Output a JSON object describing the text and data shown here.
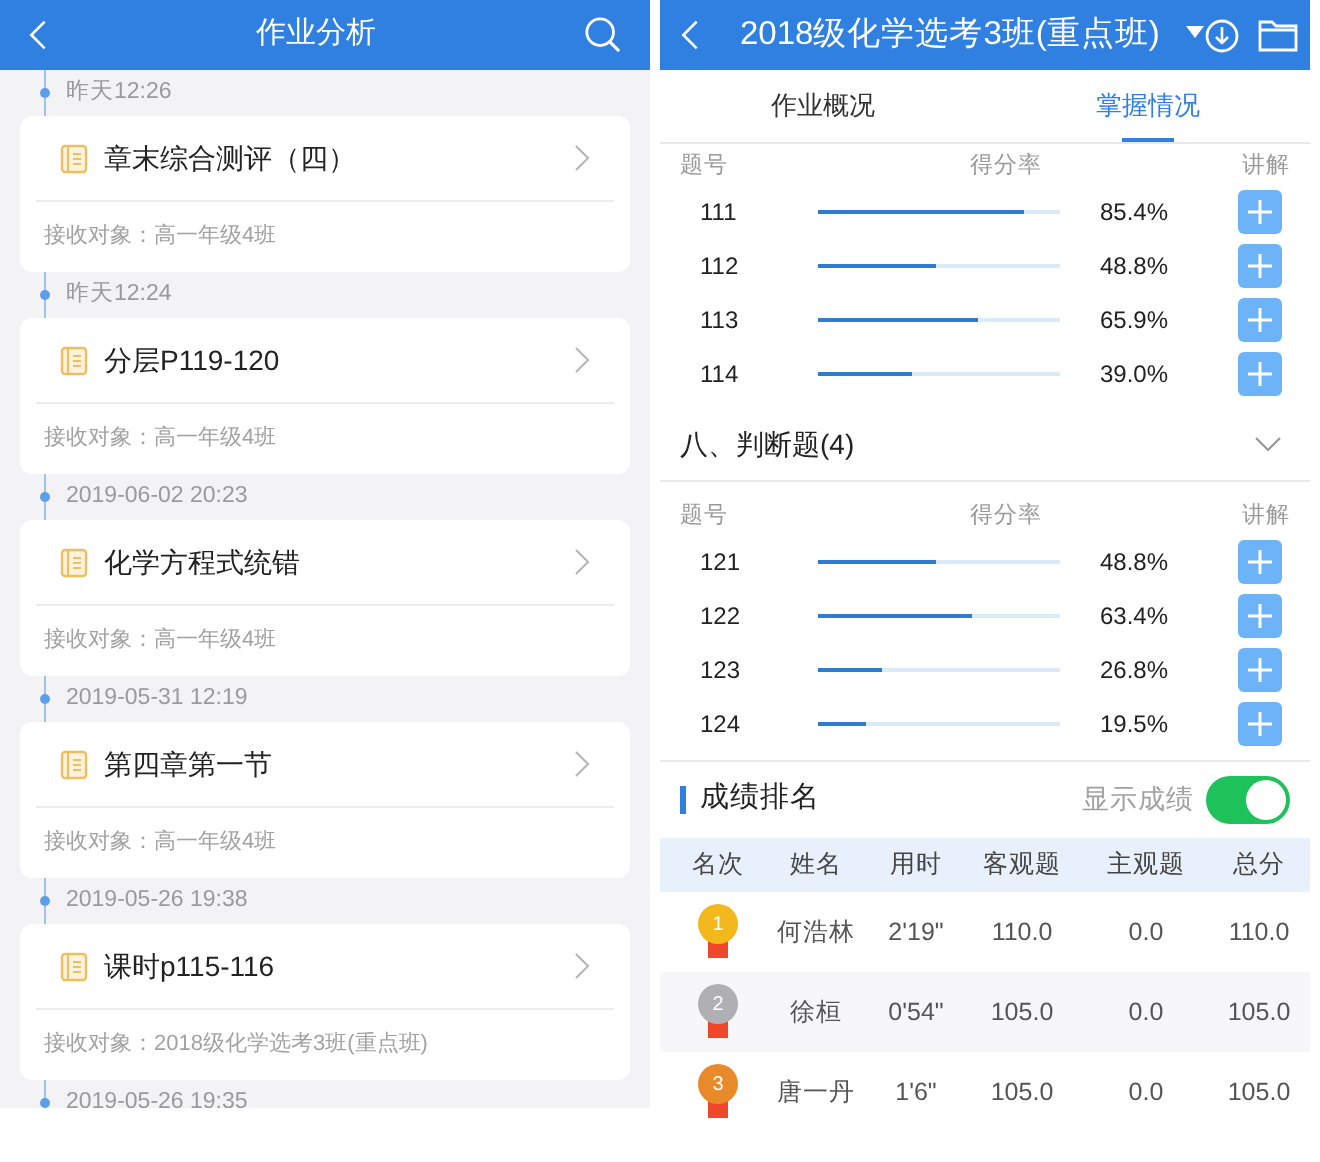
{
  "left": {
    "title": "作业分析",
    "timeline": [
      {
        "time": "昨天12:26",
        "title": "章末综合测评（四）",
        "recipient": "接收对象：高一年级4班"
      },
      {
        "time": "昨天12:24",
        "title": "分层P119-120",
        "recipient": "接收对象：高一年级4班"
      },
      {
        "time": "2019-06-02 20:23",
        "title": "化学方程式统错",
        "recipient": "接收对象：高一年级4班"
      },
      {
        "time": "2019-05-31 12:19",
        "title": "第四章第一节",
        "recipient": "接收对象：高一年级4班"
      },
      {
        "time": "2019-05-26 19:38",
        "title": "课时p115-116",
        "recipient": "接收对象：2018级化学选考3班(重点班)"
      },
      {
        "time": "2019-05-26 19:35"
      }
    ]
  },
  "right": {
    "title": "2018级化学选考3班(重点班)",
    "tabs": [
      {
        "label": "作业概况",
        "selected": false
      },
      {
        "label": "掌握情况",
        "selected": true
      }
    ],
    "groups": [
      {
        "columns": [
          "题号",
          "得分率",
          "讲解"
        ],
        "rows": [
          {
            "number": "111",
            "level": 0.854,
            "rate": "85.4%"
          },
          {
            "number": "112",
            "level": 0.488,
            "rate": "48.8%"
          },
          {
            "number": "113",
            "level": 0.659,
            "rate": "65.9%"
          },
          {
            "number": "114",
            "level": 0.39,
            "rate": "39.0%"
          }
        ]
      },
      {
        "heading": "八、判断题(4)",
        "columns": [
          "题号",
          "得分率",
          "讲解"
        ],
        "rows": [
          {
            "number": "121",
            "level": 0.488,
            "rate": "48.8%"
          },
          {
            "number": "122",
            "level": 0.634,
            "rate": "63.4%"
          },
          {
            "number": "123",
            "level": 0.268,
            "rate": "26.8%"
          },
          {
            "number": "124",
            "level": 0.195,
            "rate": "19.5%"
          }
        ]
      }
    ],
    "ranking": {
      "title": "成绩排名",
      "toggle": {
        "label": "显示成绩",
        "on": true
      },
      "columns": [
        "名次",
        "姓名",
        "用时",
        "客观题",
        "主观题",
        "总分"
      ],
      "rows": [
        {
          "rank": "1",
          "color": "#f2b81c",
          "name": "何浩林",
          "time": "2'19\"",
          "objective": "110.0",
          "subjective": "0.0",
          "total": "110.0"
        },
        {
          "rank": "2",
          "color": "#b0b0b4",
          "name": "徐桓",
          "time": "0'54\"",
          "objective": "105.0",
          "subjective": "0.0",
          "total": "105.0"
        },
        {
          "rank": "3",
          "color": "#e8892a",
          "name": "唐一丹",
          "time": "1'6\"",
          "objective": "105.0",
          "subjective": "0.0",
          "total": "105.0"
        }
      ]
    }
  }
}
